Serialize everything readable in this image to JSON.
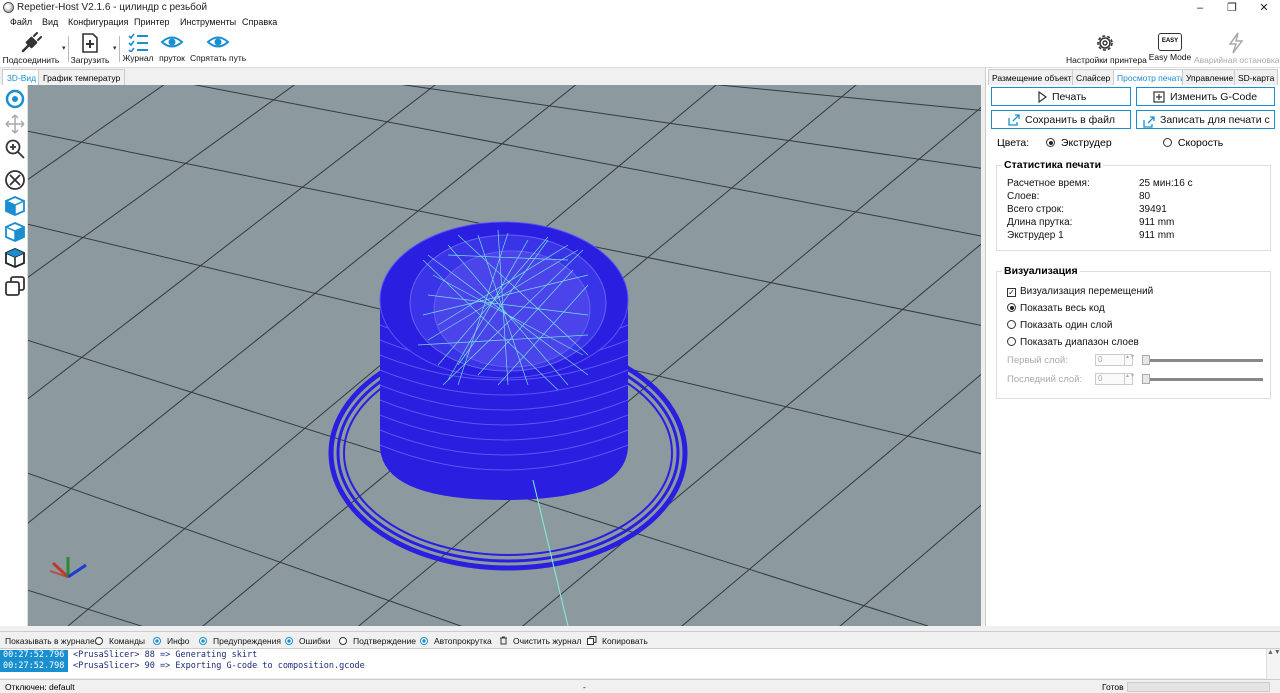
{
  "window": {
    "title": "Repetier-Host V2.1.6 - цилиндр с резьбой",
    "minimize": "–",
    "restore": "❐",
    "close": "✕"
  },
  "menu": [
    "Файл",
    "Вид",
    "Конфигурация",
    "Принтер",
    "Инструменты",
    "Справка"
  ],
  "toolbar": {
    "connect": "Подсоединить",
    "load": "Загрузить",
    "log": "Журнал",
    "filament": "пруток",
    "hide_path": "Спрятать путь",
    "printer_settings": "Настройки принтера",
    "easy_mode": "Easy Mode",
    "easy_badge": "EASY",
    "emergency_stop": "Аварийная остановка",
    "drop_arrow": "▾"
  },
  "left_tabs": [
    "3D-Вид",
    "График температур"
  ],
  "right_tabs": [
    "Размещение объекта",
    "Слайсер",
    "Просмотр печати",
    "Управление",
    "SD-карта"
  ],
  "preview": {
    "print_btn": "Печать",
    "edit_gcode_btn": "Изменить G-Code",
    "save_file_btn": "Сохранить в файл",
    "write_sd_btn": "Записать для печати с",
    "colors_label": "Цвета:",
    "color_extruder": "Экструдер",
    "color_speed": "Скорость",
    "stats_title": "Статистика печати",
    "stats": [
      {
        "label": "Расчетное время:",
        "value": "25 мин:16 с"
      },
      {
        "label": "Слоев:",
        "value": "80"
      },
      {
        "label": "Всего строк:",
        "value": "39491"
      },
      {
        "label": "Длина прутка:",
        "value": "911 mm"
      },
      {
        "label": "Экструдер 1",
        "value": "911 mm"
      }
    ],
    "vis_title": "Визуализация",
    "vis_travel": "Визуализация перемещений",
    "vis_all": "Показать весь код",
    "vis_one": "Показать один слой",
    "vis_range": "Показать диапазон слоев",
    "first_layer": "Первый слой:",
    "last_layer": "Последний слой:",
    "first_value": "0",
    "last_value": "0",
    "spin_arrows": "▲▼"
  },
  "log_options": {
    "label": "Показывать в журнале:",
    "commands": "Команды",
    "info": "Инфо",
    "warnings": "Предупреждения",
    "errors": "Ошибки",
    "ack": "Подтверждение",
    "autoscroll": "Автопрокрутка",
    "clear": "Очистить журнал",
    "copy": "Копировать"
  },
  "log": [
    {
      "time": "00:27:52.796",
      "msg": "<PrusaSlicer> 88 => Generating skirt"
    },
    {
      "time": "00:27:52.798",
      "msg": "<PrusaSlicer> 90 => Exporting G-code to composition.gcode"
    }
  ],
  "log_scroll": "▲▼",
  "status": {
    "left": "Отключен: default",
    "middle": "-",
    "right": "Готов"
  },
  "colors": {
    "accent": "#1a8fd0",
    "viewport_bg": "#8c9aa0",
    "model_blue": "#2a1ee0",
    "travel_cyan": "#7ff0e0"
  }
}
